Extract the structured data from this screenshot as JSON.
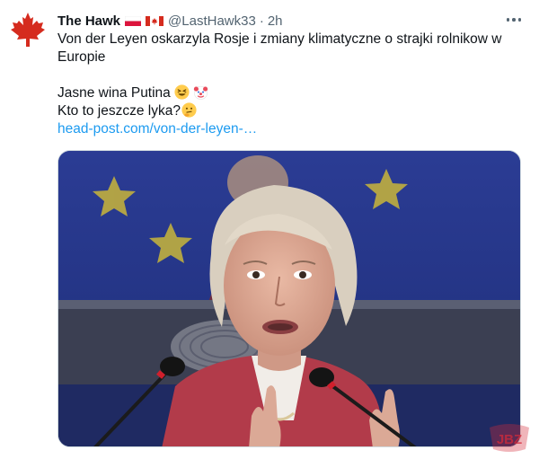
{
  "tweet": {
    "display_name": "The Hawk",
    "handle": "@LastHawk33",
    "separator": "·",
    "time": "2h",
    "flags": [
      "poland-flag",
      "canada-flag"
    ],
    "text_line_1": "Von der Leyen oskarzyla Rosje i zmiany klimatyczne o strajki rolnikow w Europie",
    "text_line_2": "Jasne wina Putina",
    "text_line_3": "Kto to jeszcze lyka?",
    "emojis": [
      "grinning-squint-emoji",
      "clown-face-emoji",
      "thinking-face-emoji"
    ],
    "link_text": "head-post.com/von-der-leyen-…",
    "avatar_icon": "maple-leaf-icon",
    "more_icon": "more-horizontal-icon"
  },
  "media": {
    "image_icon": "photo-of-woman-at-podium-microphones"
  },
  "watermark": {
    "text": "JBZ",
    "icon": "jbzd-watermark-logo"
  },
  "colors": {
    "accent_link": "#1d9bf0",
    "text_primary": "#0f1419",
    "text_secondary": "#536471",
    "avatar_red": "#d52b1e"
  }
}
